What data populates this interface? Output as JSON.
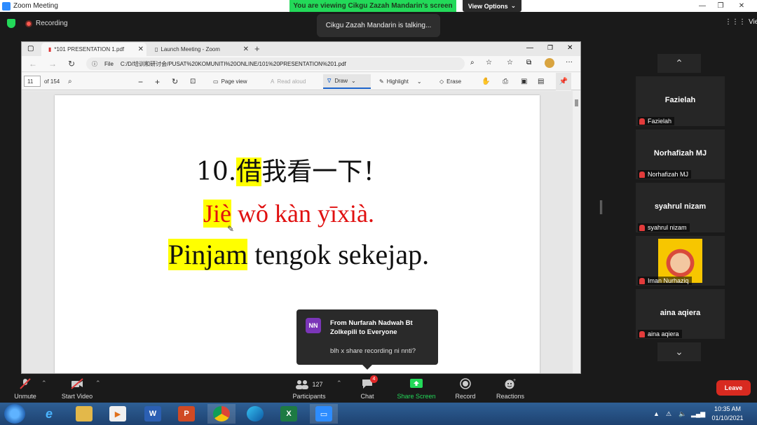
{
  "zoom": {
    "window_title": "Zoom Meeting",
    "viewing_banner": "You are viewing Cikgu Zazah Mandarin's screen",
    "view_options": "View Options",
    "recording": "Recording",
    "talking": "Cikgu Zazah Mandarin is talking...",
    "view": "View"
  },
  "browser": {
    "tabs": [
      {
        "label": "*101 PRESENTATION 1.pdf"
      },
      {
        "label": "Launch Meeting - Zoom"
      }
    ],
    "url_prefix": "File",
    "url": "C:/D/培训和研讨会/PUSAT%20KOMUNITI%20ONLINE/101%20PRESENTATION%201.pdf"
  },
  "pdf_toolbar": {
    "page": "11",
    "of_pages": "of 154",
    "page_view": "Page view",
    "read_aloud": "Read aloud",
    "draw": "Draw",
    "highlight": "Highlight",
    "erase": "Erase"
  },
  "slide": {
    "line1_num": "10.",
    "line1_hl": "借",
    "line1_rest": "我看一下！",
    "line2_hl": "Jiè",
    "line2_rest": " wǒ kàn yīxià.",
    "line3_hl": "Pinjam",
    "line3_rest": " tengok sekejap."
  },
  "chat_toast": {
    "initials": "NN",
    "from": "From Nurfarah Nadwah Bt Zolkepili to Everyone",
    "message": "blh x share recording ni nnti?"
  },
  "participants_panel": [
    {
      "name": "Fazielah",
      "label": "Fazielah",
      "has_video": false
    },
    {
      "name": "Norhafizah MJ",
      "label": "Norhafizah MJ",
      "has_video": false
    },
    {
      "name": "syahrul nizam",
      "label": "syahrul nizam",
      "has_video": false
    },
    {
      "name": "",
      "label": "Iman Nurhaziq",
      "has_video": true
    },
    {
      "name": "aina aqiera",
      "label": "aina aqiera",
      "has_video": false
    }
  ],
  "toolbar": {
    "unmute": "Unmute",
    "start_video": "Start Video",
    "participants_count": "127",
    "participants": "Participants",
    "chat": "Chat",
    "chat_badge": "4",
    "share_screen": "Share Screen",
    "record": "Record",
    "reactions": "Reactions",
    "leave": "Leave"
  },
  "taskbar": {
    "apps": [
      "windows-start",
      "internet-explorer",
      "file-explorer",
      "media-player",
      "word",
      "powerpoint",
      "chrome",
      "edge",
      "excel",
      "zoom"
    ],
    "time": "10:35 AM",
    "date": "01/10/2021"
  },
  "colors": {
    "zoom_green": "#23d959",
    "leave_red": "#d82a20",
    "slide_red": "#e01010",
    "highlight_yellow": "#ffff00"
  }
}
